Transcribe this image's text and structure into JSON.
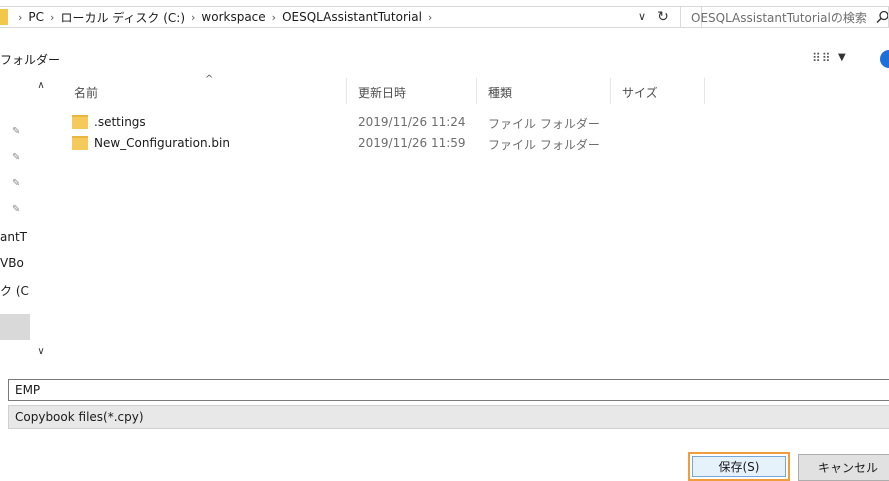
{
  "address_bar": {
    "crumbs": [
      "PC",
      "ローカル ディスク (C:)",
      "workspace",
      "OESQLAssistantTutorial"
    ],
    "separator": "›"
  },
  "search": {
    "placeholder": "OESQLAssistantTutorialの検索"
  },
  "toolbar": {
    "new_folder_label": "フォルダー",
    "view_icon_label": "⠿⠿",
    "view_arrow": "▼"
  },
  "nav_pane": {
    "items": [
      "antT",
      "VBo",
      "ク (C"
    ]
  },
  "file_list": {
    "columns": [
      "名前",
      "更新日時",
      "種類",
      "サイズ"
    ],
    "rows": [
      {
        "name": ".settings",
        "modified": "2019/11/26 11:24",
        "type": "ファイル フォルダー",
        "size": ""
      },
      {
        "name": "New_Configuration.bin",
        "modified": "2019/11/26 11:59",
        "type": "ファイル フォルダー",
        "size": ""
      }
    ]
  },
  "filename": {
    "value": "EMP"
  },
  "filetype": {
    "selected": "Copybook files(*.cpy)"
  },
  "buttons": {
    "save_label": "保存(S)",
    "cancel_label": "キャンセル"
  },
  "colors": {
    "accent": "#f19c3d",
    "folder": "#f5c95a",
    "selected_nav": "#d9d9d9"
  },
  "icons": [
    "folder-icon",
    "refresh-icon",
    "search-icon",
    "pin-icon",
    "view-icon",
    "help-icon",
    "chevron-up-icon",
    "chevron-down-icon"
  ]
}
